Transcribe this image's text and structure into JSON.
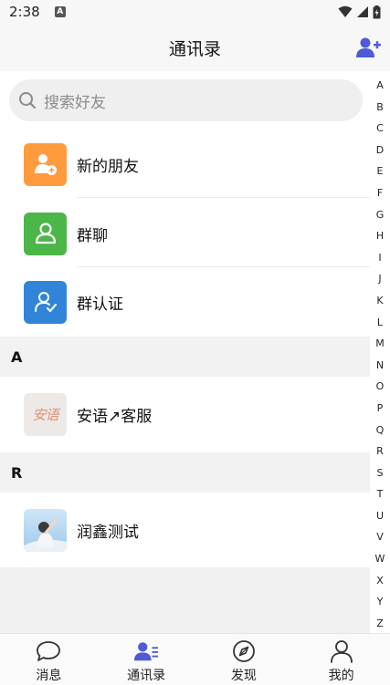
{
  "status_bar": {
    "time": "2:38",
    "notification_glyph": "A"
  },
  "header": {
    "title": "通讯录"
  },
  "search": {
    "placeholder": "搜索好友"
  },
  "menu": [
    {
      "label": "新的朋友",
      "icon": "new-friend-icon",
      "color": "#ff9a3e"
    },
    {
      "label": "群聊",
      "icon": "group-chat-icon",
      "color": "#4cb648"
    },
    {
      "label": "群认证",
      "icon": "group-verify-icon",
      "color": "#3185d8"
    }
  ],
  "sections": [
    {
      "letter": "A",
      "contacts": [
        {
          "name": "安语↗客服",
          "avatar_text": "安语"
        }
      ]
    },
    {
      "letter": "R",
      "contacts": [
        {
          "name": "润鑫测试"
        }
      ]
    }
  ],
  "index_letters": [
    "A",
    "B",
    "C",
    "D",
    "E",
    "F",
    "G",
    "H",
    "I",
    "J",
    "K",
    "L",
    "M",
    "N",
    "O",
    "P",
    "Q",
    "R",
    "S",
    "T",
    "U",
    "V",
    "W",
    "X",
    "Y",
    "Z"
  ],
  "tabs": [
    {
      "label": "消息",
      "icon": "chat-bubble-icon",
      "active": false
    },
    {
      "label": "通讯录",
      "icon": "contacts-icon",
      "active": true
    },
    {
      "label": "发现",
      "icon": "compass-icon",
      "active": false
    },
    {
      "label": "我的",
      "icon": "profile-icon",
      "active": false
    }
  ],
  "colors": {
    "accent": "#4f5bd5",
    "section_bg": "#f2f2f2"
  }
}
